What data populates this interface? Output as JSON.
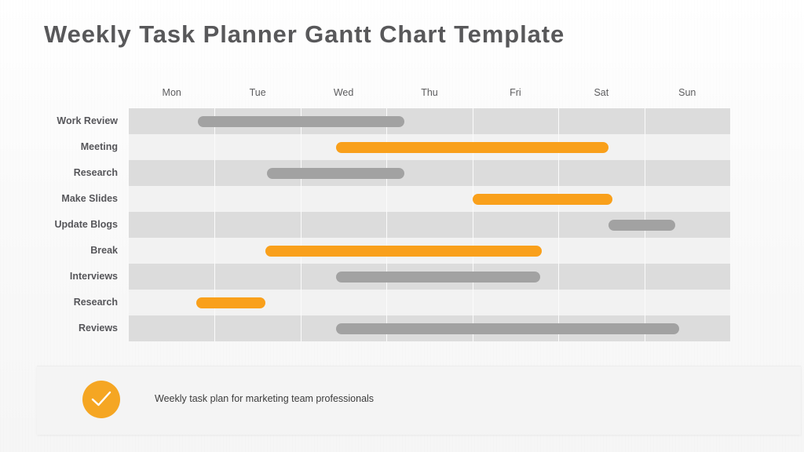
{
  "slide": {
    "title": "Weekly Task Planner Gantt Chart Template"
  },
  "caption": {
    "icon": "check-circle-icon",
    "text": "Weekly task plan for marketing team professionals"
  },
  "colors": {
    "title": "#58585a",
    "accent_orange": "#f9a01b",
    "bar_gray": "#a2a2a2",
    "row_odd": "#dcdcdc",
    "row_even": "#f2f2f2",
    "background": "#fbfbfb"
  },
  "chart_data": {
    "type": "bar",
    "subtype": "gantt",
    "title": "Weekly Task Planner Gantt Chart Template",
    "xlabel": "",
    "ylabel": "",
    "grid": true,
    "legend": "none",
    "x_unit": "day",
    "categories": [
      "Mon",
      "Tue",
      "Wed",
      "Thu",
      "Fri",
      "Sat",
      "Sun"
    ],
    "xlim": [
      0,
      7
    ],
    "tasks": [
      "Work Review",
      "Meeting",
      "Research",
      "Make Slides",
      "Update Blogs",
      "Break",
      "Interviews",
      "Research",
      "Reviews"
    ],
    "bars": [
      {
        "task": "Work Review",
        "start": 0.8,
        "end": 3.21,
        "duration": 2.41,
        "color": "#a2a2a2",
        "series": "gray"
      },
      {
        "task": "Meeting",
        "start": 2.41,
        "end": 5.58,
        "duration": 3.17,
        "color": "#f9a01b",
        "series": "orange"
      },
      {
        "task": "Research",
        "start": 1.61,
        "end": 3.21,
        "duration": 1.6,
        "color": "#a2a2a2",
        "series": "gray"
      },
      {
        "task": "Make Slides",
        "start": 4.0,
        "end": 5.63,
        "duration": 1.63,
        "color": "#f9a01b",
        "series": "orange"
      },
      {
        "task": "Update Blogs",
        "start": 5.58,
        "end": 6.36,
        "duration": 0.78,
        "color": "#a2a2a2",
        "series": "gray"
      },
      {
        "task": "Break",
        "start": 1.59,
        "end": 4.81,
        "duration": 3.22,
        "color": "#f9a01b",
        "series": "orange"
      },
      {
        "task": "Interviews",
        "start": 2.41,
        "end": 4.79,
        "duration": 2.38,
        "color": "#a2a2a2",
        "series": "gray"
      },
      {
        "task": "Research",
        "start": 0.79,
        "end": 1.59,
        "duration": 0.8,
        "color": "#f9a01b",
        "series": "orange"
      },
      {
        "task": "Reviews",
        "start": 2.41,
        "end": 6.41,
        "duration": 4.0,
        "color": "#a2a2a2",
        "series": "gray"
      }
    ]
  }
}
